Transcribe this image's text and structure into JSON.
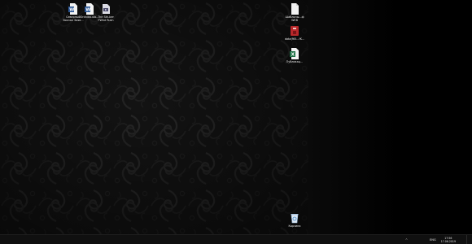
{
  "desktop": {
    "icons": [
      {
        "label": "Северный Вокзал Заяв...",
        "icon": "word-document-icon",
        "color": "#2b5797"
      },
      {
        "label": "Ordnika.ula...",
        "icon": "word-document-icon",
        "color": "#2b5797"
      },
      {
        "label": "The Sth-ber FWhd Rush",
        "icon": "video-file-icon",
        "color": "#6a6a8a"
      },
      {
        "label": "Шаблоны...ф WEB",
        "icon": "blank-document-icon",
        "color": "#e8e8e8"
      },
      {
        "label": "data(f65...fK...",
        "icon": "red-archive-icon",
        "color": "#b8282a"
      },
      {
        "label": "Публикац...",
        "icon": "excel-document-icon",
        "color": "#1e7145"
      },
      {
        "label": "Корзина",
        "icon": "recycle-bin-icon",
        "color": "#6ea6d8"
      }
    ]
  },
  "taskbar": {
    "tray": {
      "overflow_chevron": "^",
      "language": "ENG",
      "time": "17:56",
      "date": "17.06.2019"
    }
  },
  "colors": {
    "wallpaper": "#121212",
    "taskbar": "#101010",
    "text": "#f0f0f0"
  }
}
